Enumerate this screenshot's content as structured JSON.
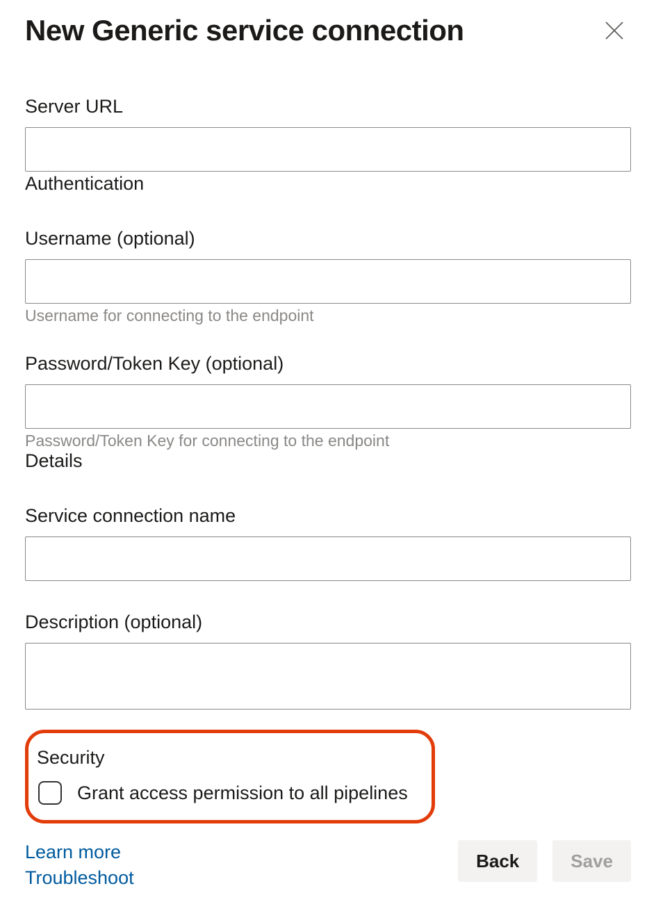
{
  "header": {
    "title": "New Generic service connection"
  },
  "fields": {
    "server_url_label": "Server URL",
    "server_url_value": "",
    "authentication_heading": "Authentication",
    "username_label": "Username (optional)",
    "username_value": "",
    "username_helper": "Username for connecting to the endpoint",
    "password_label": "Password/Token Key (optional)",
    "password_value": "",
    "password_helper": "Password/Token Key for connecting to the endpoint",
    "details_heading": "Details",
    "conn_name_label": "Service connection name",
    "conn_name_value": "",
    "description_label": "Description (optional)",
    "description_value": ""
  },
  "security": {
    "heading": "Security",
    "checkbox_label": "Grant access permission to all pipelines",
    "checked": false
  },
  "footer": {
    "learn_more": "Learn more",
    "troubleshoot": "Troubleshoot",
    "back": "Back",
    "save": "Save"
  }
}
